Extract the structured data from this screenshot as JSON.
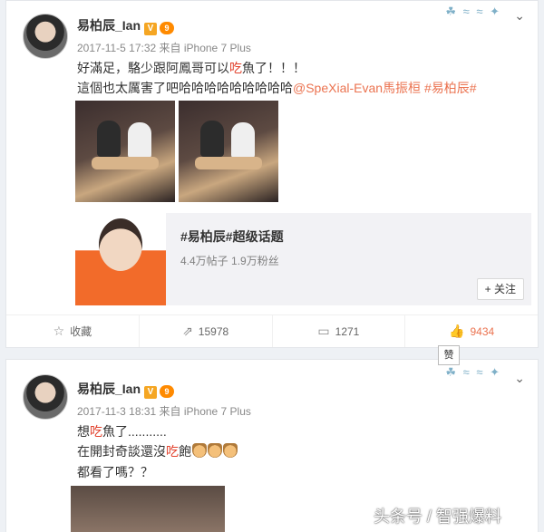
{
  "post1": {
    "user": "易柏辰_Ian",
    "verified_badge": "V",
    "level_badge": "9",
    "meta": "2017-11-5 17:32 来自 iPhone 7 Plus",
    "line1_a": "好滿足，駱少跟阿鳳哥可以",
    "line1_hl": "吃",
    "line1_b": "魚了！！！",
    "line2_a": "這個也太厲害了吧哈哈哈哈哈哈哈哈哈",
    "mention": "@SpeXial-Evan馬振桓",
    "hashtag": "#易柏辰#",
    "share": {
      "title": "#易柏辰#超级话题",
      "stats": "4.4万帖子 1.9万粉丝",
      "follow": "+ 关注"
    },
    "actions": {
      "favorite": "收藏",
      "forward": "15978",
      "comment": "1271",
      "like": "9434"
    },
    "tooltip": "赞"
  },
  "post2": {
    "user": "易柏辰_Ian",
    "verified_badge": "V",
    "level_badge": "9",
    "meta": "2017-11-3 18:31 来自 iPhone 7 Plus",
    "line1_a": "想",
    "line1_hl": "吃",
    "line1_b": "魚了...........",
    "line2_a": "在開封奇談還沒",
    "line2_hl": "吃",
    "line2_b": "飽",
    "line3": "都看了嗎？？"
  },
  "watermark": "头条号 / 智强爆料",
  "icons": {
    "favorite": "star-icon",
    "forward": "forward-icon",
    "comment": "comment-icon",
    "like": "thumb-up-icon",
    "more": "chevron-down-icon"
  },
  "colors": {
    "link": "#eb7350",
    "highlight": "#e2412c"
  }
}
